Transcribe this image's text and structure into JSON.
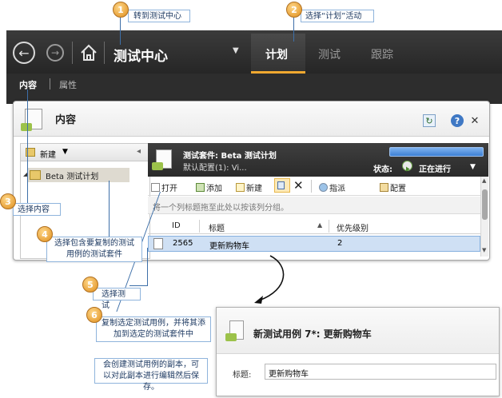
{
  "callouts": {
    "c1": {
      "num": "1",
      "text": "转到测试中心"
    },
    "c2": {
      "num": "2",
      "text": "选择“计划”活动"
    },
    "c3": {
      "num": "3",
      "text": "选择内容"
    },
    "c4": {
      "num": "4",
      "text": "选择包含要复制的测试用例的测试套件"
    },
    "c5": {
      "num": "5",
      "text": "选择测试"
    },
    "c6": {
      "num": "6",
      "text": "复制选定测试用例，并将其添加到选定的测试套件中"
    },
    "note": {
      "text": "会创建测试用例的副本，可以对此副本进行编辑然后保存。"
    }
  },
  "appbar": {
    "title": "测试中心",
    "dropdown_glyph": "▼",
    "tabs": [
      {
        "label": "计划",
        "active": true
      },
      {
        "label": "测试",
        "active": false
      },
      {
        "label": "跟踪",
        "active": false
      }
    ],
    "subtabs": [
      {
        "label": "内容",
        "active": true
      },
      {
        "label": "属性",
        "active": false
      }
    ],
    "accent": "#f0a830",
    "background": "#2d2d2d"
  },
  "panel": {
    "title": "内容",
    "help": "?",
    "close": "✕"
  },
  "tree": {
    "new_label": "新建",
    "new_caret": "▼",
    "item": {
      "expander": "◢",
      "label": "Beta 测试计划"
    }
  },
  "suite": {
    "title": "测试套件: Beta 测试计划",
    "config": "默认配置(1): Vi...",
    "status_label": "状态:",
    "status_value": "正在进行",
    "status_caret": "▼"
  },
  "toolbar": {
    "open": "打开",
    "add": "添加",
    "new": "新建",
    "assign": "指派",
    "configure": "配置"
  },
  "grid": {
    "group_hint": "将一个列标题拖至此处以按该列分组。",
    "columns": {
      "id": "ID",
      "title": "标题",
      "priority": "优先级别"
    },
    "sort_glyph": "▲",
    "rows": [
      {
        "id": "2565",
        "title": "更新购物车",
        "priority": "2"
      }
    ]
  },
  "dialog": {
    "title": "新测试用例 7*: 更新购物车",
    "field_label": "标题:",
    "field_value": "更新购物车"
  }
}
